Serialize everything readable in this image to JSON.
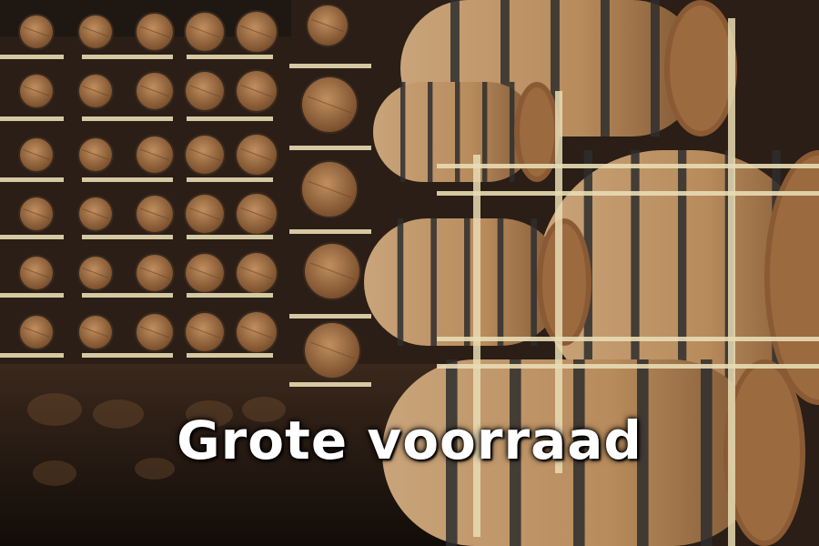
{
  "caption": {
    "text": "Grote voorraad",
    "color": "#ffffff"
  },
  "scene": {
    "description_icon": "barrel-warehouse-photo",
    "colors": {
      "floor": "#2a1c14",
      "wall": "#3a2a1e",
      "oak": "#b98a5e",
      "oak_dark": "#8a5f3a",
      "barrel_end": "#9c6a3f",
      "hoop": "#2e2e2e",
      "rack": "#e8dcb4"
    }
  }
}
